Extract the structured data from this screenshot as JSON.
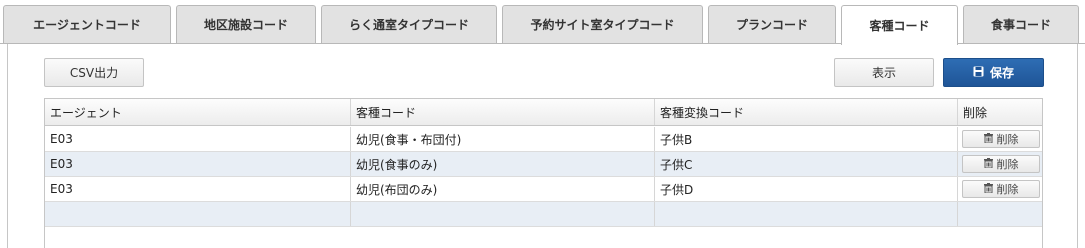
{
  "tabs": [
    {
      "label": "エージェントコード",
      "active": false
    },
    {
      "label": "地区施設コード",
      "active": false
    },
    {
      "label": "らく通室タイプコード",
      "active": false
    },
    {
      "label": "予約サイト室タイプコード",
      "active": false
    },
    {
      "label": "プランコード",
      "active": false
    },
    {
      "label": "客種コード",
      "active": true
    },
    {
      "label": "食事コード",
      "active": false
    }
  ],
  "toolbar": {
    "csv_label": "CSV出力",
    "show_label": "表示",
    "save_label": "保存",
    "save_icon": "floppy-disk-icon"
  },
  "grid": {
    "columns": [
      "エージェント",
      "客種コード",
      "客種変換コード",
      "削除"
    ],
    "rows": [
      {
        "agent": "E03",
        "code": "幼児(食事・布団付)",
        "conv": "子供B",
        "delete_label": "削除"
      },
      {
        "agent": "E03",
        "code": "幼児(食事のみ)",
        "conv": "子供C",
        "delete_label": "削除"
      },
      {
        "agent": "E03",
        "code": "幼児(布団のみ)",
        "conv": "子供D",
        "delete_label": "削除"
      }
    ],
    "delete_icon": "trash-icon",
    "row_alt_color": "#e8eef5"
  },
  "colors": {
    "primary": "#2566ad",
    "tab_bg": "#e2e2e2",
    "border": "#c6c6c6"
  }
}
